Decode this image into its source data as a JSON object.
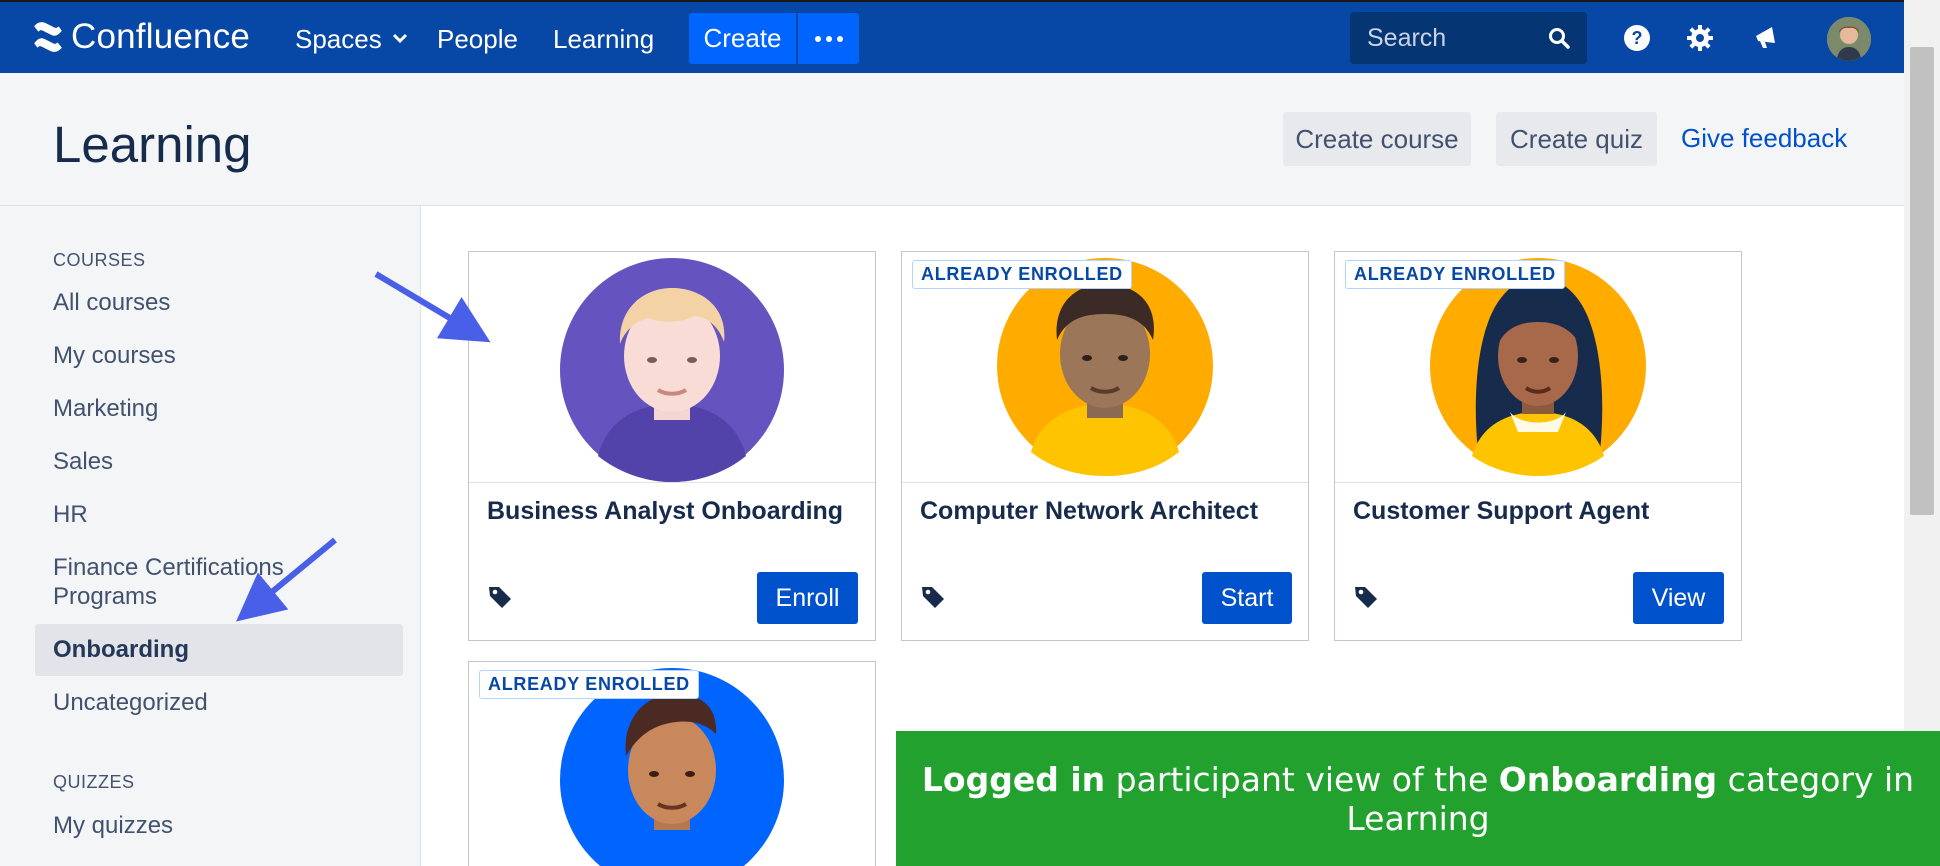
{
  "nav": {
    "logo_text": "Confluence",
    "spaces": "Spaces",
    "people": "People",
    "learning": "Learning",
    "create": "Create",
    "search_placeholder": "Search"
  },
  "header": {
    "title": "Learning",
    "create_course": "Create course",
    "create_quiz": "Create quiz",
    "give_feedback": "Give feedback"
  },
  "sidebar": {
    "courses_heading": "COURSES",
    "items": [
      "All courses",
      "My courses",
      "Marketing",
      "Sales",
      "HR",
      "Finance Certifications Programs",
      "Onboarding",
      "Uncategorized"
    ],
    "active": "Onboarding",
    "quizzes_heading": "QUIZZES",
    "quiz_items": [
      "My quizzes"
    ]
  },
  "cards": [
    {
      "title": "Business Analyst Onboarding",
      "badge": "",
      "button": "Enroll",
      "avatar_bg": "#6554c0"
    },
    {
      "title": "Computer Network Architect",
      "badge": "ALREADY ENROLLED",
      "button": "Start",
      "avatar_bg": "#ffab00"
    },
    {
      "title": "Customer Support Agent",
      "badge": "ALREADY ENROLLED",
      "button": "View",
      "avatar_bg": "#ffab00"
    },
    {
      "title": "",
      "badge": "ALREADY ENROLLED",
      "button": "",
      "avatar_bg": "#0065ff"
    }
  ],
  "caption": {
    "bold1": "Logged in",
    "text1": " participant view of the ",
    "bold2": "Onboarding",
    "text2": " category in Learning"
  },
  "colors": {
    "nav_bg": "#0747a6",
    "primary": "#0052cc",
    "caption_bg": "#22a12f",
    "arrow": "#4a5fe8"
  }
}
